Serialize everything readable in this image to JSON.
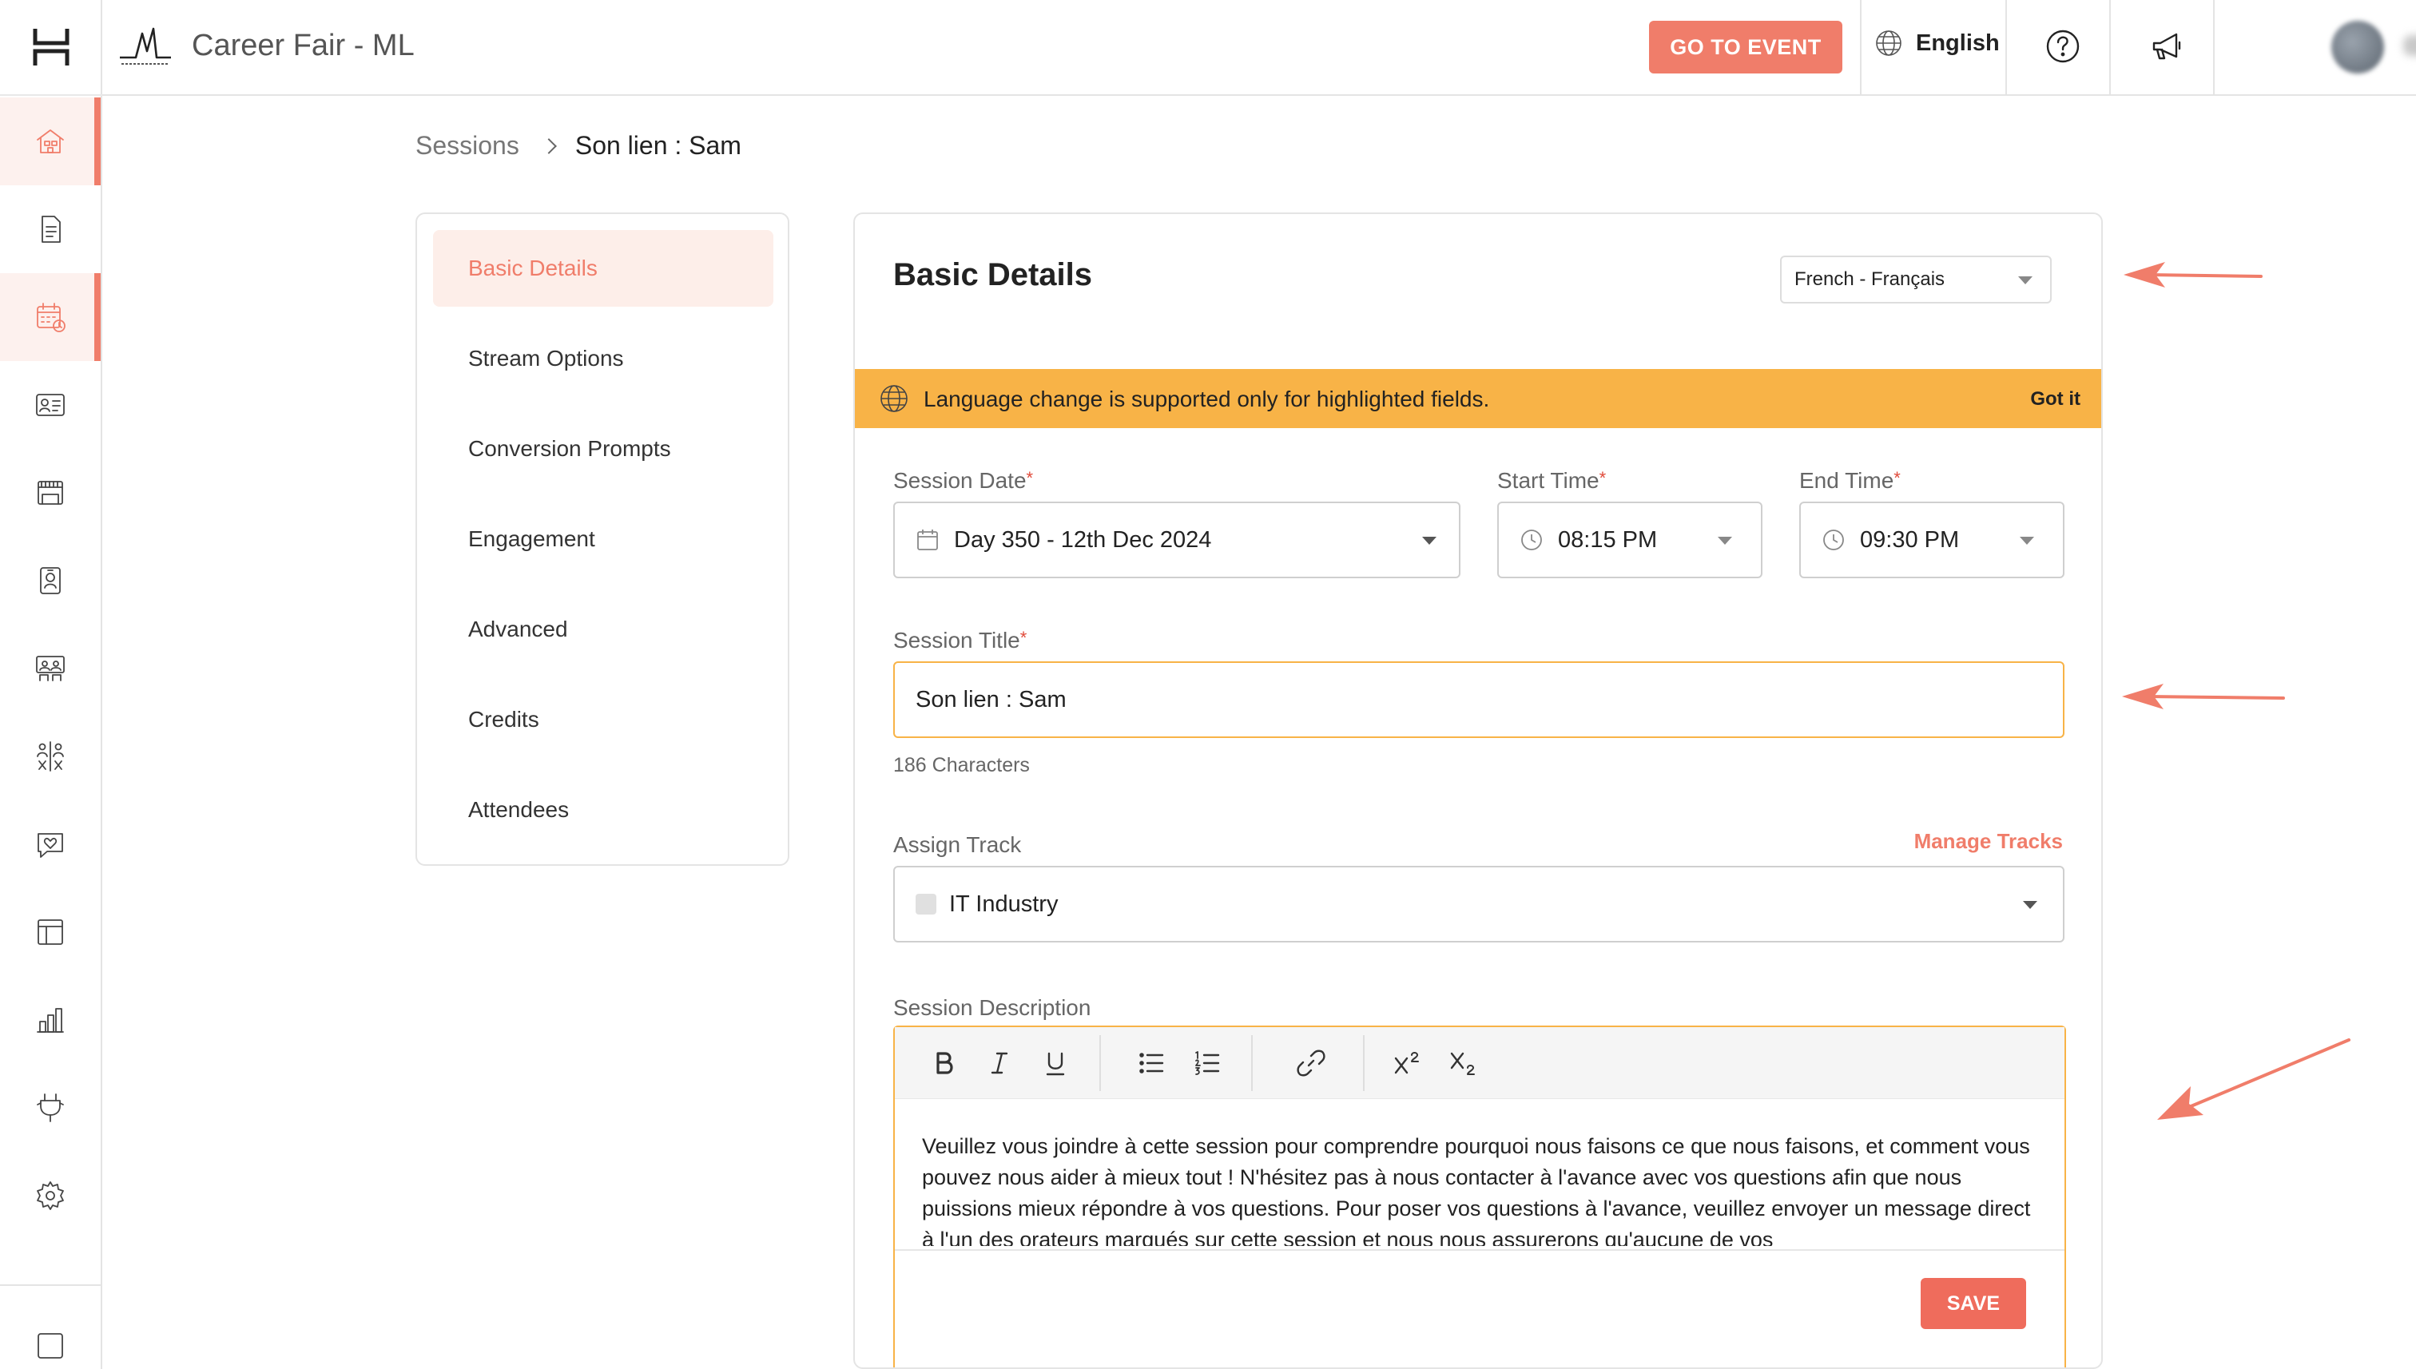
{
  "app": {
    "event_title": "Career Fair - ML",
    "go_to_event": "GO TO EVENT",
    "language": "English"
  },
  "rail": {
    "items": [
      "home-icon",
      "document-icon",
      "calendar-icon",
      "id-card-icon",
      "booth-icon",
      "badge-icon",
      "lounge-icon",
      "networking-icon",
      "engagement-icon",
      "layout-icon",
      "analytics-icon",
      "integrations-icon",
      "settings-icon"
    ],
    "active": [
      "home-icon",
      "calendar-icon"
    ]
  },
  "breadcrumb": {
    "parent": "Sessions",
    "current": "Son lien : Sam"
  },
  "nav": {
    "items": [
      "Basic Details",
      "Stream Options",
      "Conversion Prompts",
      "Engagement",
      "Advanced",
      "Credits",
      "Attendees"
    ],
    "active_index": 0
  },
  "form": {
    "title": "Basic Details",
    "content_language": "French - Français",
    "banner": {
      "text": "Language change is supported only for highlighted fields.",
      "button": "Got it"
    },
    "session_date": {
      "label": "Session Date",
      "value": "Day 350 - 12th Dec 2024"
    },
    "start_time": {
      "label": "Start Time",
      "value": "08:15 PM"
    },
    "end_time": {
      "label": "End Time",
      "value": "09:30 PM"
    },
    "session_title": {
      "label": "Session Title",
      "value": "Son lien : Sam",
      "char_count": "186 Characters"
    },
    "assign_track": {
      "label": "Assign Track",
      "manage_link": "Manage Tracks",
      "value": "IT Industry"
    },
    "session_description": {
      "label": "Session Description",
      "text": "Veuillez vous joindre à cette session pour comprendre pourquoi nous faisons ce que nous faisons, et comment vous pouvez nous aider à mieux tout ! N'hésitez pas à nous contacter à l'avance avec vos questions afin que nous puissions mieux répondre à vos questions. Pour poser vos questions à l'avance, veuillez envoyer un message direct à l'un des orateurs marqués sur cette session et nous nous assurerons qu'aucune de vos"
    },
    "save": "SAVE"
  },
  "colors": {
    "accent": "#f07d6a",
    "banner": "#f8b347",
    "highlight_border": "#f8b347"
  }
}
